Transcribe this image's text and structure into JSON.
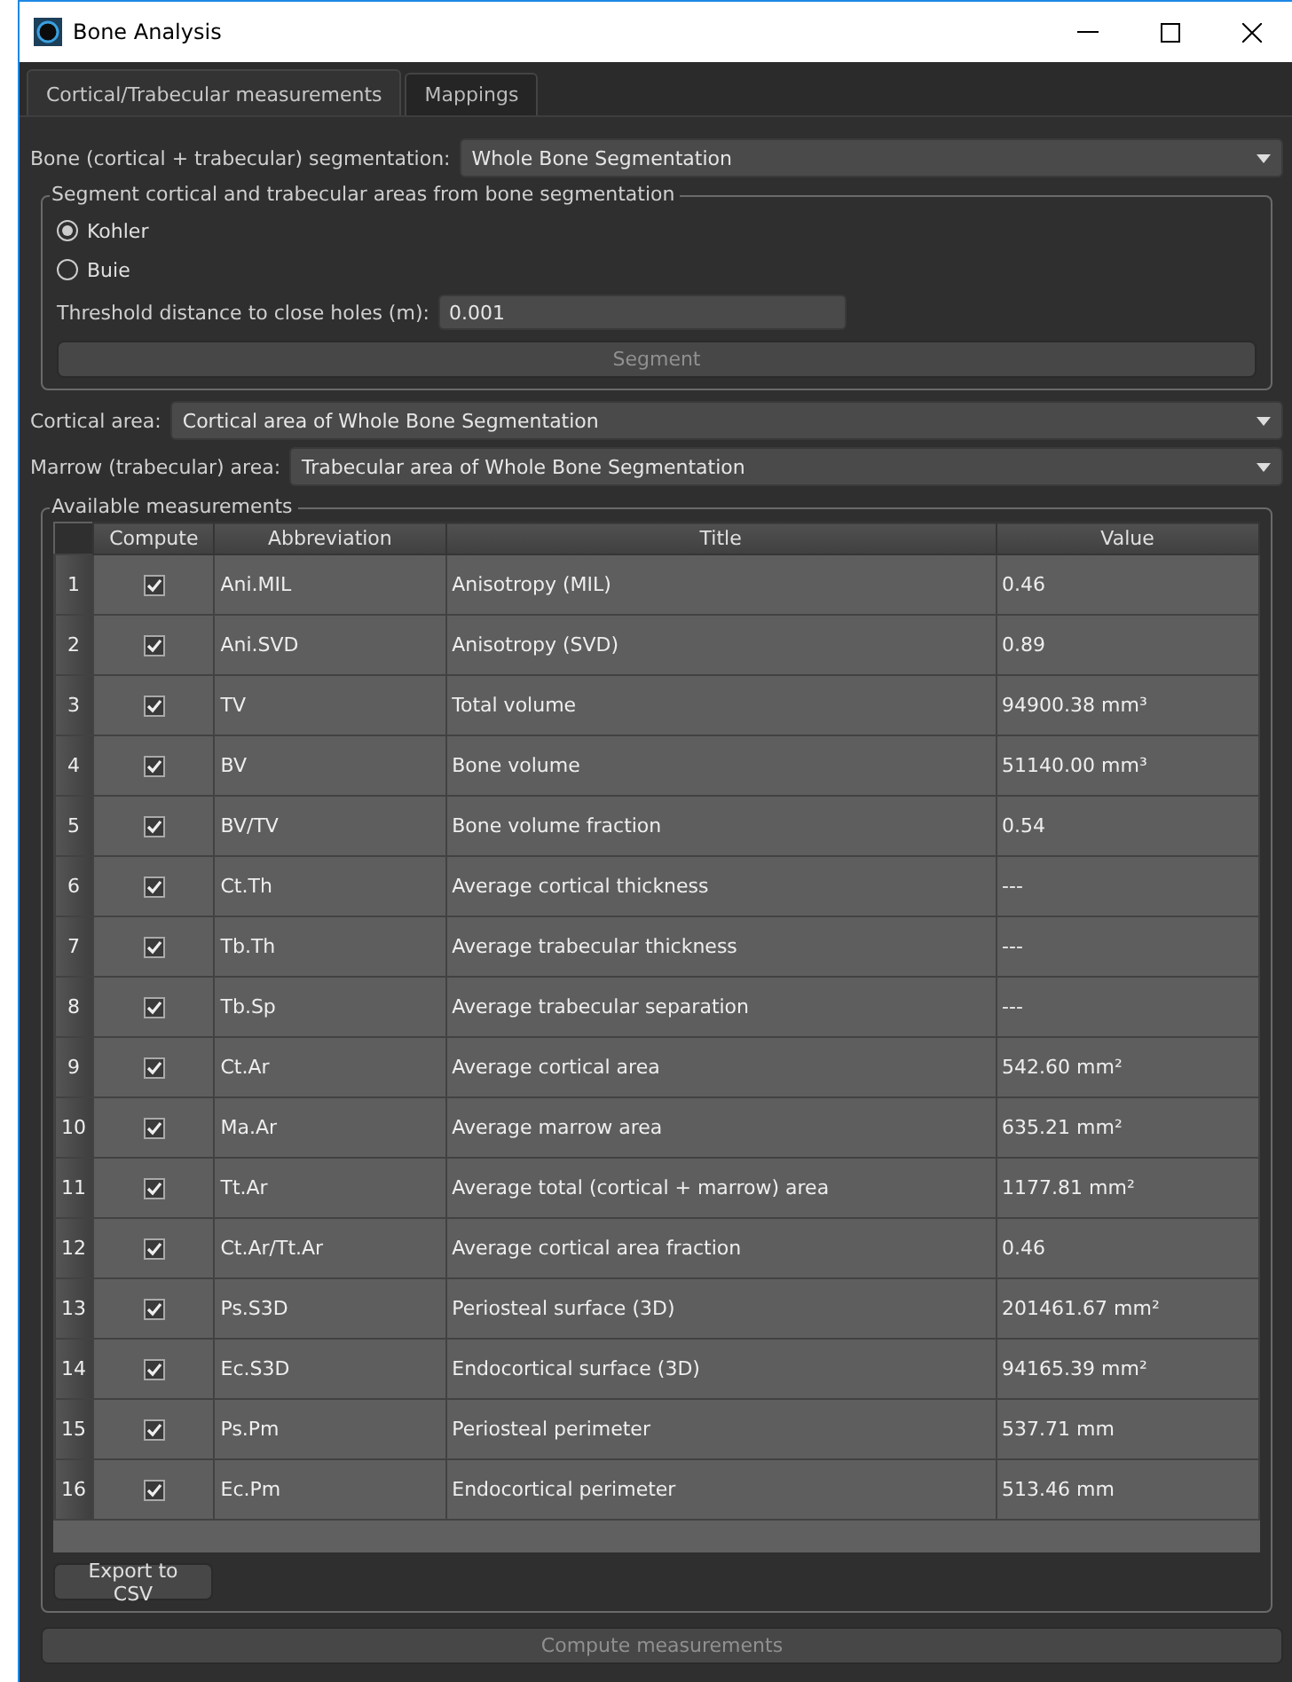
{
  "window": {
    "title": "Bone Analysis"
  },
  "tabs": [
    {
      "label": "Cortical/Trabecular measurements",
      "selected": true
    },
    {
      "label": "Mappings",
      "selected": false
    }
  ],
  "bone_segmentation": {
    "label": "Bone (cortical + trabecular) segmentation:",
    "value": "Whole Bone Segmentation"
  },
  "segment_group": {
    "title": "Segment cortical and trabecular areas from bone segmentation",
    "methods": [
      {
        "label": "Kohler",
        "selected": true
      },
      {
        "label": "Buie",
        "selected": false
      }
    ],
    "threshold": {
      "label": "Threshold distance to close holes (m):",
      "value": "0.001"
    },
    "segment_button": {
      "label": "Segment",
      "disabled": true
    }
  },
  "cortical_area": {
    "label": "Cortical area:",
    "value": "Cortical area of Whole Bone Segmentation"
  },
  "marrow_area": {
    "label": "Marrow (trabecular) area:",
    "value": "Trabecular area of Whole Bone Segmentation"
  },
  "measurements": {
    "title": "Available measurements",
    "columns": [
      "Compute",
      "Abbreviation",
      "Title",
      "Value"
    ],
    "rows": [
      {
        "index": "1",
        "compute": true,
        "abbreviation": "Ani.MIL",
        "title": "Anisotropy (MIL)",
        "value": "0.46"
      },
      {
        "index": "2",
        "compute": true,
        "abbreviation": "Ani.SVD",
        "title": "Anisotropy (SVD)",
        "value": "0.89"
      },
      {
        "index": "3",
        "compute": true,
        "abbreviation": "TV",
        "title": "Total volume",
        "value": "94900.38 mm³"
      },
      {
        "index": "4",
        "compute": true,
        "abbreviation": "BV",
        "title": "Bone volume",
        "value": "51140.00 mm³"
      },
      {
        "index": "5",
        "compute": true,
        "abbreviation": "BV/TV",
        "title": "Bone volume fraction",
        "value": "0.54"
      },
      {
        "index": "6",
        "compute": true,
        "abbreviation": "Ct.Th",
        "title": "Average cortical thickness",
        "value": "---"
      },
      {
        "index": "7",
        "compute": true,
        "abbreviation": "Tb.Th",
        "title": "Average trabecular thickness",
        "value": "---"
      },
      {
        "index": "8",
        "compute": true,
        "abbreviation": "Tb.Sp",
        "title": "Average trabecular separation",
        "value": "---"
      },
      {
        "index": "9",
        "compute": true,
        "abbreviation": "Ct.Ar",
        "title": "Average cortical area",
        "value": "542.60 mm²"
      },
      {
        "index": "10",
        "compute": true,
        "abbreviation": "Ma.Ar",
        "title": "Average marrow area",
        "value": "635.21 mm²"
      },
      {
        "index": "11",
        "compute": true,
        "abbreviation": "Tt.Ar",
        "title": "Average total (cortical + marrow) area",
        "value": "1177.81 mm²"
      },
      {
        "index": "12",
        "compute": true,
        "abbreviation": "Ct.Ar/Tt.Ar",
        "title": "Average cortical area fraction",
        "value": "0.46"
      },
      {
        "index": "13",
        "compute": true,
        "abbreviation": "Ps.S3D",
        "title": "Periosteal surface (3D)",
        "value": "201461.67 mm²"
      },
      {
        "index": "14",
        "compute": true,
        "abbreviation": "Ec.S3D",
        "title": "Endocortical surface (3D)",
        "value": "94165.39 mm²"
      },
      {
        "index": "15",
        "compute": true,
        "abbreviation": "Ps.Pm",
        "title": "Periosteal perimeter",
        "value": "537.71 mm"
      },
      {
        "index": "16",
        "compute": true,
        "abbreviation": "Ec.Pm",
        "title": "Endocortical perimeter",
        "value": "513.46 mm"
      }
    ],
    "export_button": "Export to CSV"
  },
  "compute_button": "Compute measurements"
}
